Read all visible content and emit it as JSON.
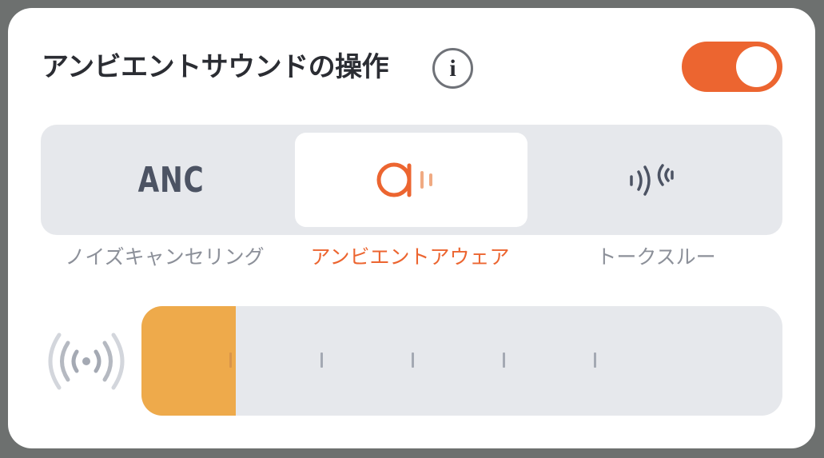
{
  "panel": {
    "title": "アンビエントサウンドの操作",
    "info_icon": "info-icon",
    "info_glyph": "i",
    "toggle": {
      "state": "on",
      "color": "#ec6530"
    }
  },
  "modes": [
    {
      "icon": "anc-icon",
      "icon_text": "ANC",
      "label": "ノイズキャンセリング",
      "selected": false
    },
    {
      "icon": "ambient-aware-icon",
      "label": "アンビエントアウェア",
      "selected": true
    },
    {
      "icon": "talk-through-icon",
      "label": "トークスルー",
      "selected": false
    }
  ],
  "level": {
    "icon": "broadcast-signal-icon",
    "steps": 7,
    "value": 1,
    "fill_color": "#eeaa4b"
  },
  "colors": {
    "accent": "#ec6530",
    "track": "#e6e8ec",
    "text": "#2b2d33",
    "muted": "#8c9099"
  }
}
